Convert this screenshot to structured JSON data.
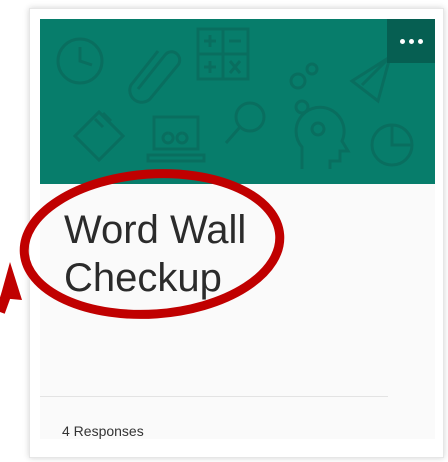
{
  "form_card": {
    "title": "Word Wall Checkup",
    "responses_label": "4 Responses",
    "more_options_icon": "more-horizontal-icon"
  },
  "theme": {
    "banner_color": "#077d6b",
    "more_button_color": "#065f52",
    "annotation_color": "#c00000"
  },
  "banner_icons": [
    "clock-icon",
    "paperclip-icon",
    "calculator-icon",
    "gears-icon",
    "paper-plane-icon",
    "ruler-icon",
    "laptop-icon",
    "magnifier-icon",
    "head-gears-icon",
    "pie-chart-icon"
  ]
}
